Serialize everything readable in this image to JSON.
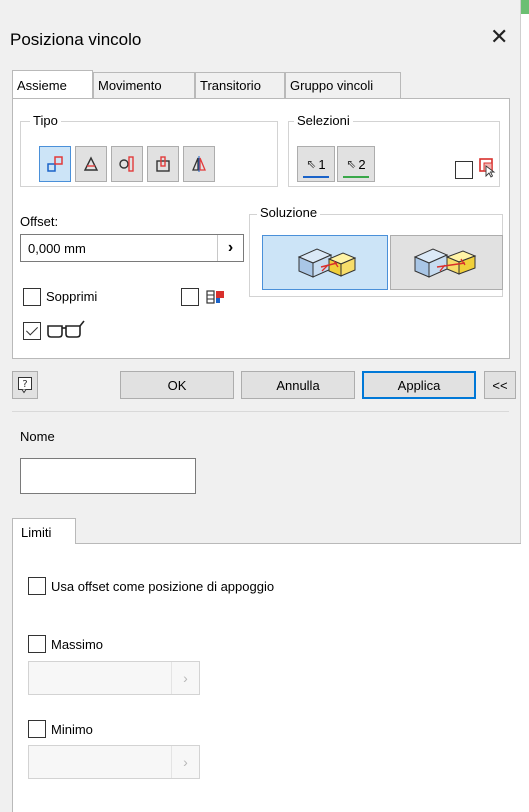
{
  "window": {
    "title": "Posiziona vincolo",
    "close_glyph": "✕"
  },
  "tabs": [
    {
      "label": "Assieme",
      "active": true
    },
    {
      "label": "Movimento",
      "active": false
    },
    {
      "label": "Transitorio",
      "active": false
    },
    {
      "label": "Gruppo vincoli",
      "active": false
    }
  ],
  "tipo": {
    "label": "Tipo",
    "buttons": [
      "mate-constraint-icon",
      "angle-constraint-icon",
      "tangent-constraint-icon",
      "insert-constraint-icon",
      "symmetry-constraint-icon"
    ]
  },
  "selezioni": {
    "label": "Selezioni",
    "sel1": "1",
    "sel2": "2"
  },
  "offset": {
    "label": "Offset:",
    "value": "0,000 mm",
    "arrow": "›"
  },
  "soluzione": {
    "label": "Soluzione"
  },
  "options": {
    "sopprimi_label": "Sopprimi",
    "sopprimi_checked": false,
    "predict_checked": false,
    "preview_checked": true
  },
  "buttons": {
    "ok": "OK",
    "cancel": "Annulla",
    "apply": "Applica",
    "expand": "<<"
  },
  "nome": {
    "label": "Nome",
    "value": ""
  },
  "limiti": {
    "tab_label": "Limiti",
    "use_offset_label": "Usa offset come posizione di appoggio",
    "max_label": "Massimo",
    "min_label": "Minimo",
    "arrow": "›"
  },
  "colors": {
    "accent": "#0078d7",
    "selected_bg": "#cce4f7",
    "window_bg": "#f0f0f0",
    "corner_green": "#6cbf73"
  }
}
